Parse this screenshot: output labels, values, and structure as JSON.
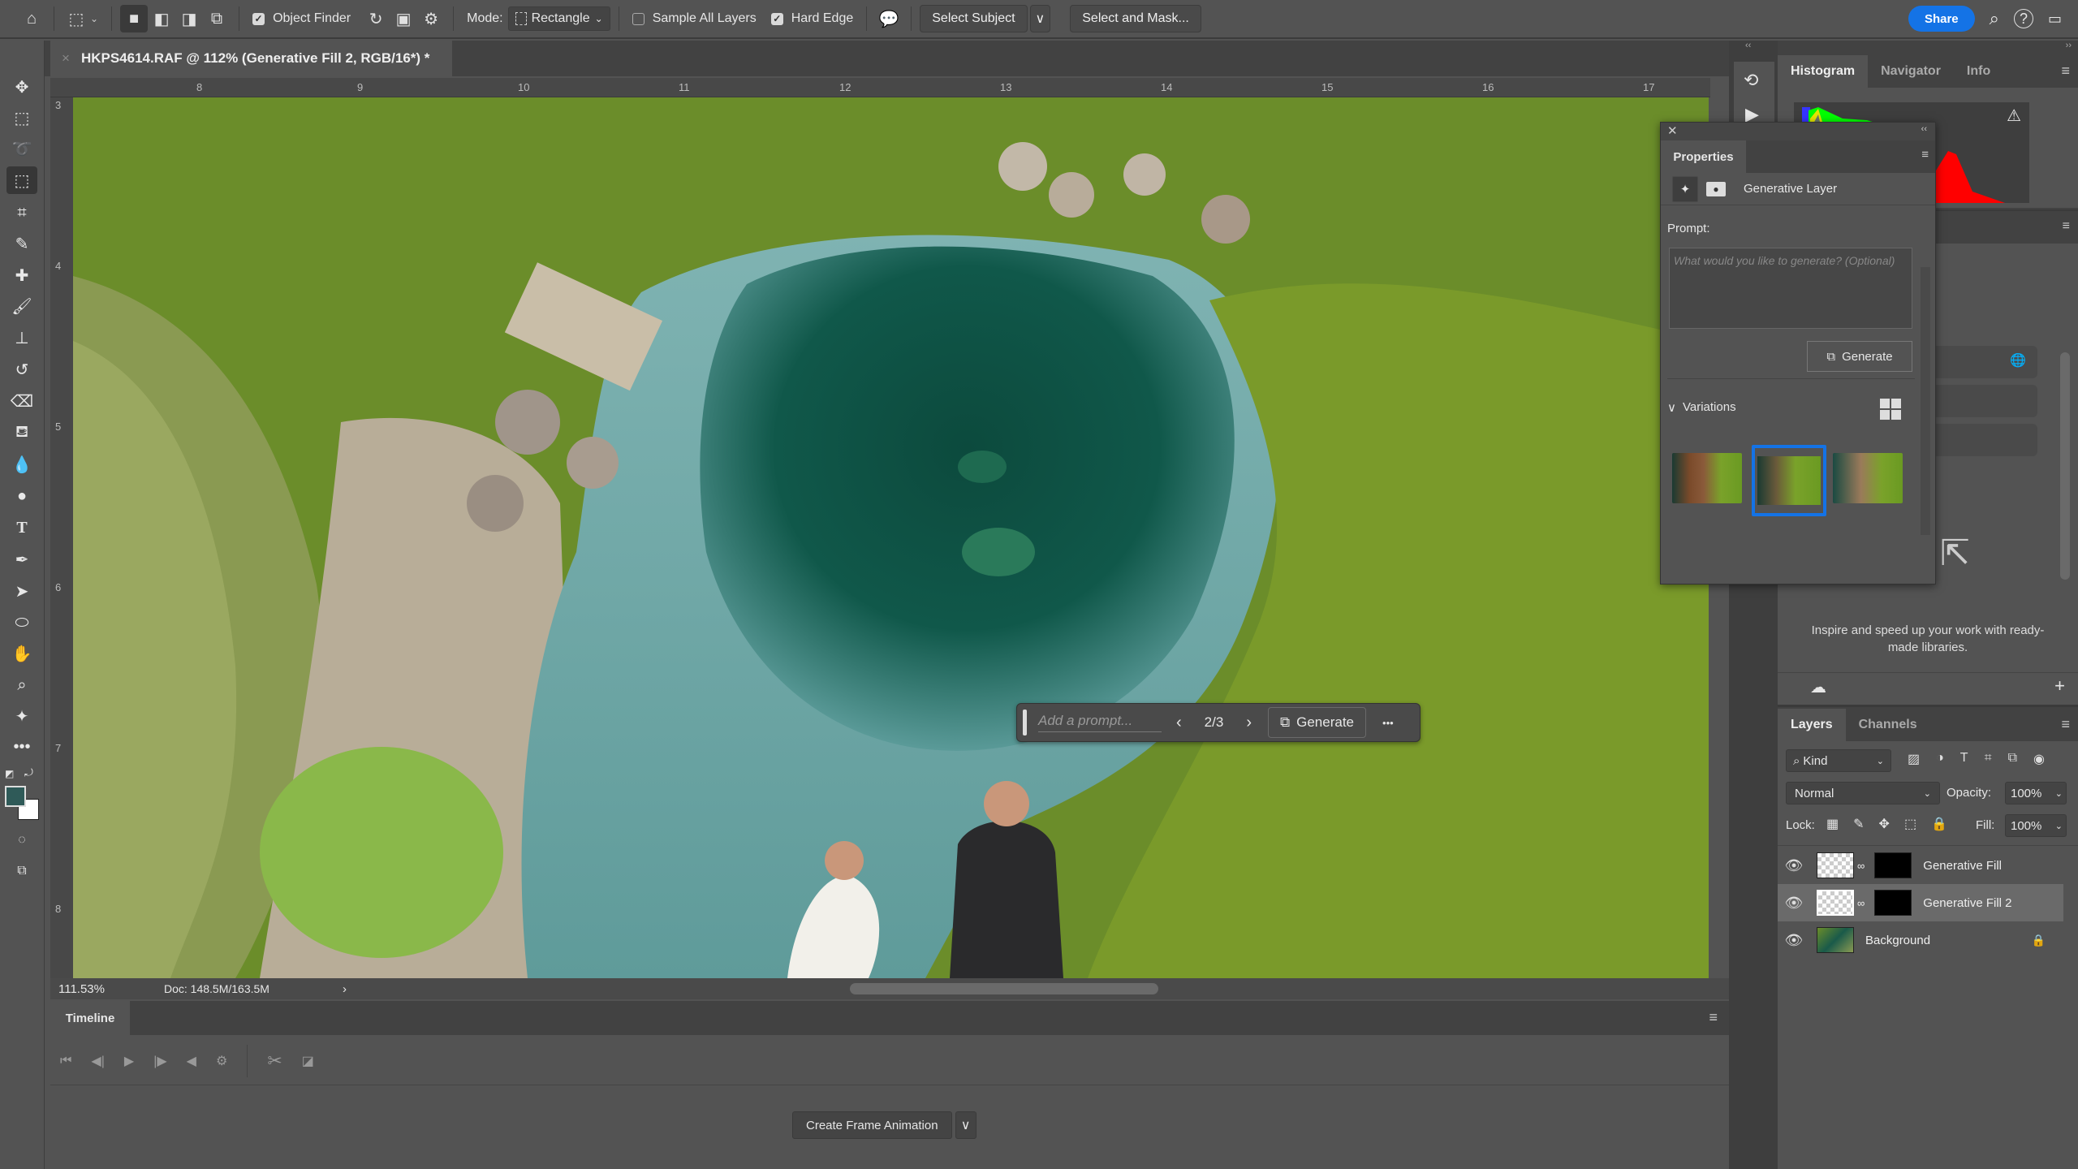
{
  "options_bar": {
    "home_icon": "home-icon",
    "tool_preset_icon": "object-selection-tool-icon",
    "object_finder": {
      "label": "Object Finder",
      "checked": true
    },
    "mode_label": "Mode:",
    "mode_value": "Rectangle",
    "sample_all_layers": {
      "label": "Sample All Layers",
      "checked": false
    },
    "hard_edge": {
      "label": "Hard Edge",
      "checked": true
    },
    "select_subject": "Select Subject",
    "select_and_mask": "Select and Mask...",
    "share": "Share"
  },
  "document": {
    "tab_title": "HKPS4614.RAF @ 112% (Generative Fill 2, RGB/16*) *",
    "close": "×"
  },
  "rulers": {
    "top": [
      "8",
      "9",
      "10",
      "11",
      "12",
      "13",
      "14",
      "15",
      "16",
      "17"
    ],
    "left": [
      "3",
      "4",
      "5",
      "6",
      "7",
      "8"
    ]
  },
  "contextual_taskbar": {
    "prompt_placeholder": "Add a prompt...",
    "variation_counter": "2/3",
    "generate_label": "Generate",
    "more": "•••"
  },
  "status_bar": {
    "zoom": "111.53%",
    "doc_size": "Doc: 148.5M/163.5M",
    "arrow": "›"
  },
  "timeline": {
    "tab": "Timeline",
    "create_button": "Create Frame Animation"
  },
  "histogram_panel": {
    "tabs": [
      "Histogram",
      "Navigator",
      "Info"
    ],
    "active_tab": "Histogram",
    "warning_icon": "⚠"
  },
  "properties_panel": {
    "title": "Properties",
    "layer_type": "Generative Layer",
    "prompt_label": "Prompt:",
    "prompt_placeholder": "What would you like to generate? (Optional)",
    "generate_label": "Generate",
    "variations_label": "Variations",
    "variations": [
      {
        "name": "Variation 1",
        "selected": false
      },
      {
        "name": "Variation 2",
        "selected": true
      },
      {
        "name": "Variation 3",
        "selected": false
      }
    ]
  },
  "libraries_panel": {
    "hint": "Inspire and speed up your work with ready-made libraries."
  },
  "layers_panel": {
    "tabs": [
      "Layers",
      "Channels"
    ],
    "active_tab": "Layers",
    "filter_label": "Kind",
    "blend_mode": "Normal",
    "opacity_label": "Opacity:",
    "opacity_value": "100%",
    "lock_label": "Lock:",
    "fill_label": "Fill:",
    "fill_value": "100%",
    "layers": [
      {
        "name": "Generative Fill",
        "visible": true,
        "selected": false
      },
      {
        "name": "Generative Fill 2",
        "visible": true,
        "selected": true
      },
      {
        "name": "Background",
        "visible": true,
        "selected": false,
        "locked": true
      }
    ]
  },
  "colors": {
    "accent": "#1473e6",
    "foreground_swatch": "#2f5a58",
    "background_swatch": "#ffffff"
  }
}
